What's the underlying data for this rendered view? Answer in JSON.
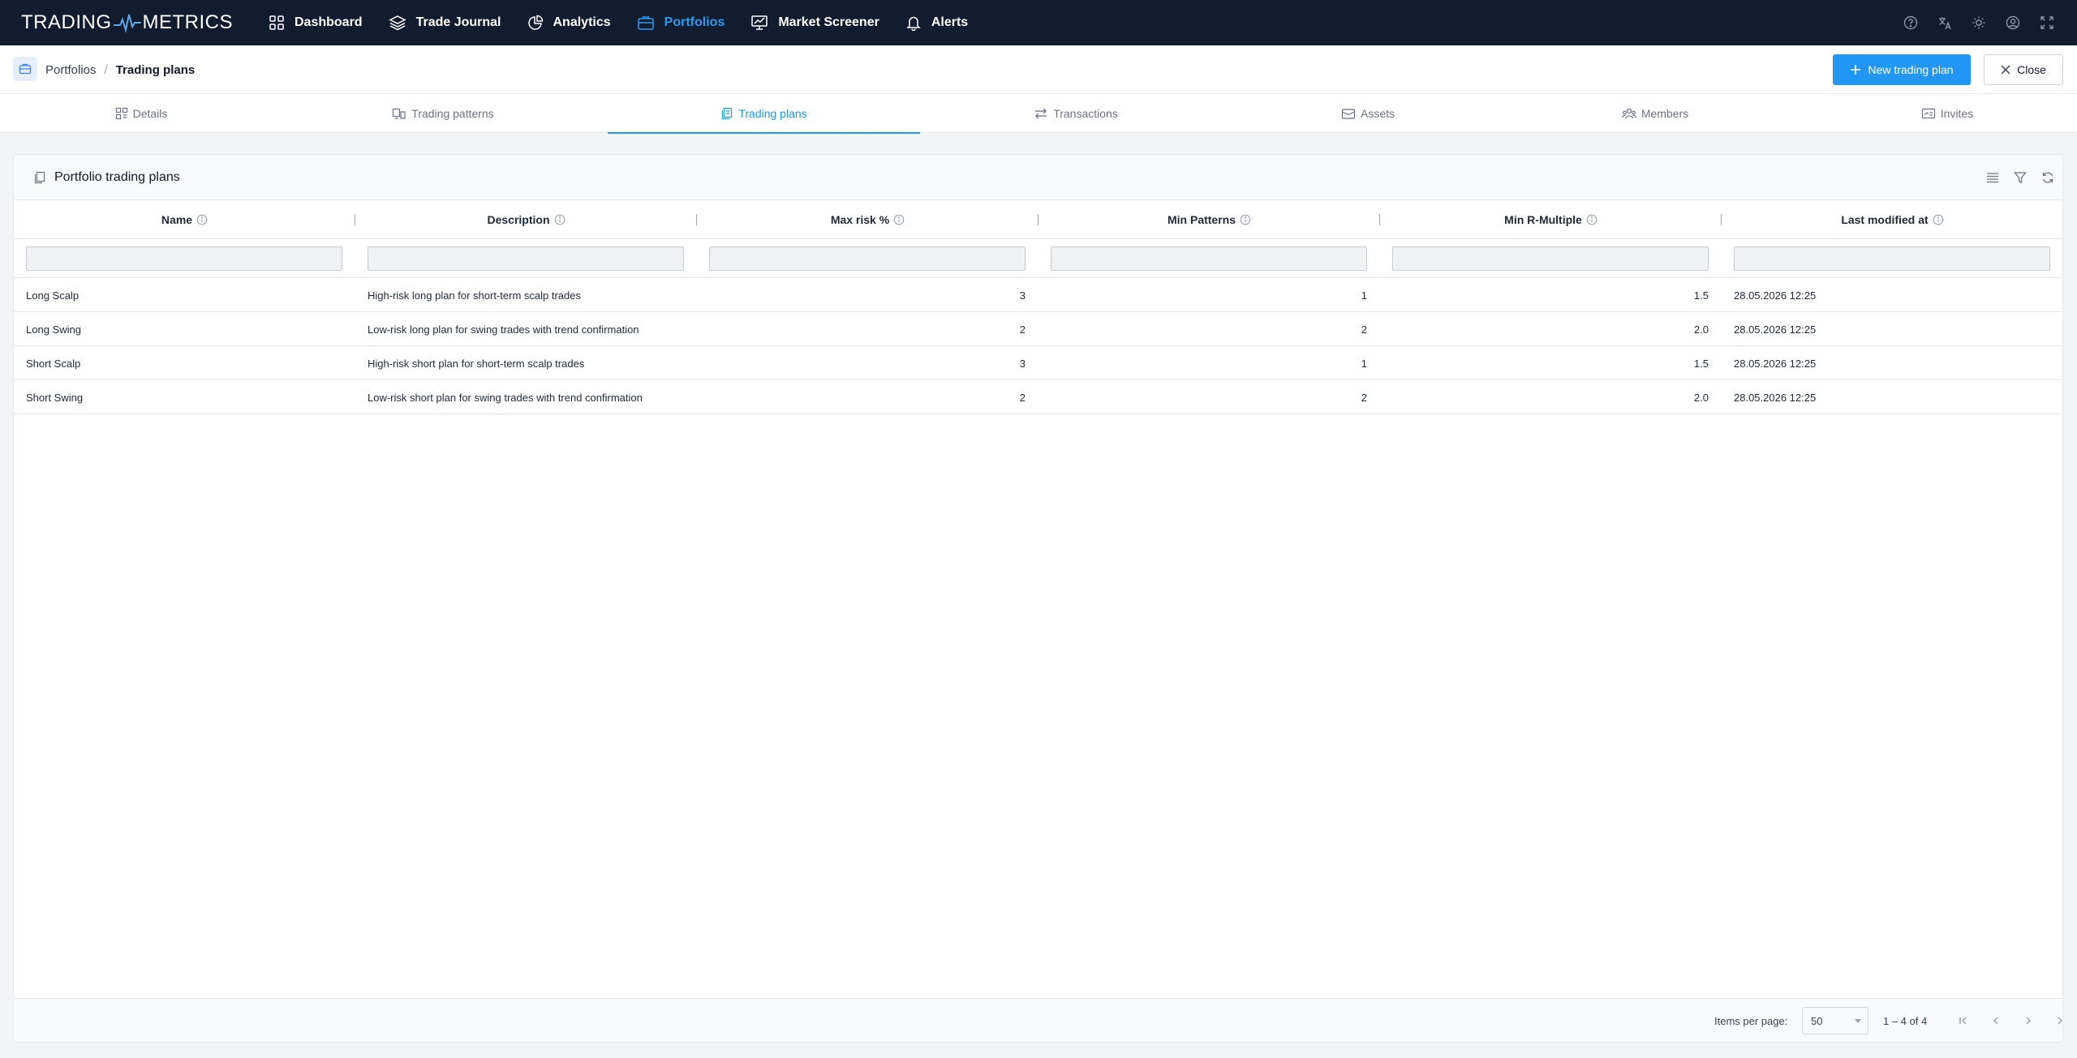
{
  "app": {
    "logo_left": "TRADING",
    "logo_right": "METRICS",
    "nav": [
      {
        "label": "Dashboard",
        "icon": "grid-icon"
      },
      {
        "label": "Trade Journal",
        "icon": "layers-icon"
      },
      {
        "label": "Analytics",
        "icon": "pie-chart-icon"
      },
      {
        "label": "Portfolios",
        "icon": "briefcase-icon",
        "active": true
      },
      {
        "label": "Market Screener",
        "icon": "screener-icon"
      },
      {
        "label": "Alerts",
        "icon": "bell-icon"
      }
    ],
    "right_icons": [
      "help-icon",
      "translate-icon",
      "theme-sun-icon",
      "account-icon",
      "fullscreen-icon"
    ]
  },
  "breadcrumb": {
    "parent": "Portfolios",
    "separator": "/",
    "current": "Trading plans"
  },
  "actions": {
    "new_label": "New trading plan",
    "close_label": "Close"
  },
  "tabs": [
    {
      "label": "Details",
      "icon": "details-icon"
    },
    {
      "label": "Trading patterns",
      "icon": "patterns-icon"
    },
    {
      "label": "Trading plans",
      "icon": "plans-icon",
      "active": true
    },
    {
      "label": "Transactions",
      "icon": "transfer-icon"
    },
    {
      "label": "Assets",
      "icon": "wallet-icon"
    },
    {
      "label": "Members",
      "icon": "members-icon"
    },
    {
      "label": "Invites",
      "icon": "invites-icon"
    }
  ],
  "card": {
    "title": "Portfolio trading plans",
    "tools": [
      "columns-icon",
      "filter-icon",
      "refresh-icon"
    ]
  },
  "table": {
    "columns": [
      "Name",
      "Description",
      "Max risk %",
      "Min Patterns",
      "Min R-Multiple",
      "Last modified at"
    ],
    "filters": [
      "",
      "",
      "",
      "",
      "",
      ""
    ],
    "rows": [
      {
        "name": "Long Scalp",
        "description": "High-risk long plan for short-term scalp trades",
        "max_risk": "3",
        "min_patterns": "1",
        "min_r": "1.5",
        "modified": "28.05.2026 12:25"
      },
      {
        "name": "Long Swing",
        "description": "Low-risk long plan for swing trades with trend confirmation",
        "max_risk": "2",
        "min_patterns": "2",
        "min_r": "2.0",
        "modified": "28.05.2026 12:25"
      },
      {
        "name": "Short Scalp",
        "description": "High-risk short plan for short-term scalp trades",
        "max_risk": "3",
        "min_patterns": "1",
        "min_r": "1.5",
        "modified": "28.05.2026 12:25"
      },
      {
        "name": "Short Swing",
        "description": "Low-risk short plan for swing trades with trend confirmation",
        "max_risk": "2",
        "min_patterns": "2",
        "min_r": "2.0",
        "modified": "28.05.2026 12:25"
      }
    ]
  },
  "pagination": {
    "items_per_page_label": "Items per page:",
    "items_per_page": "50",
    "range": "1 – 4 of 4",
    "controls": [
      "first-page-icon",
      "prev-page-icon",
      "next-page-icon",
      "last-page-icon"
    ]
  },
  "colors": {
    "nav_bg": "#111c2f",
    "accent": "#2196f3",
    "active_nav": "#2f9bf0"
  }
}
